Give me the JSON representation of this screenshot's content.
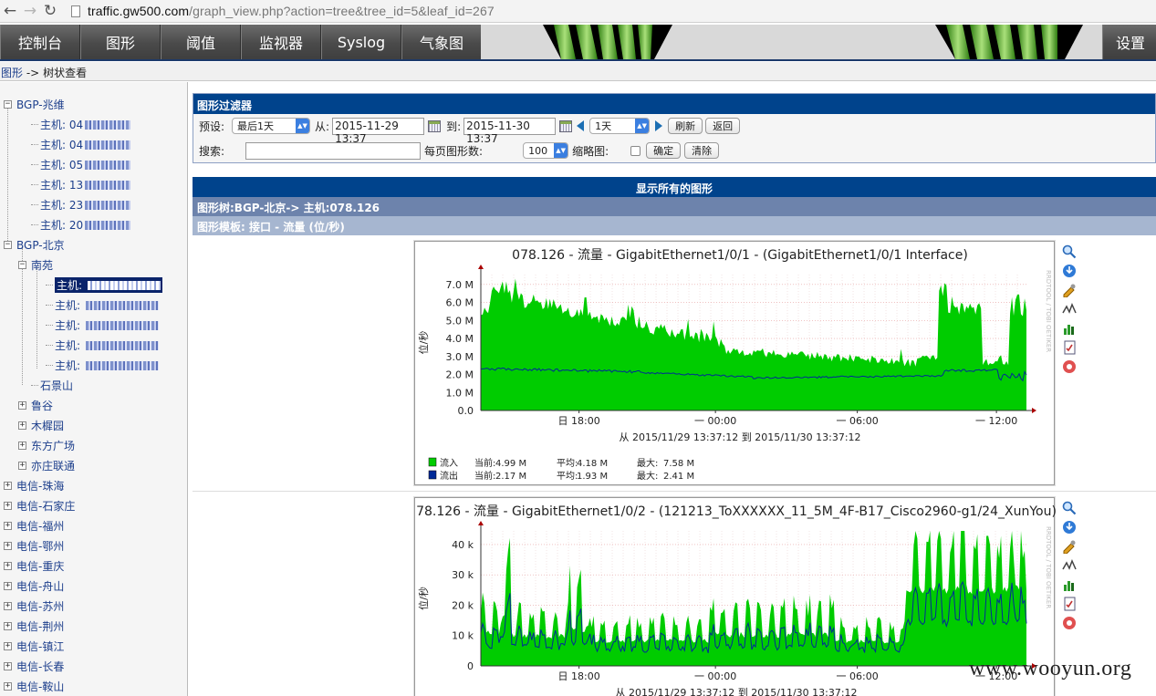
{
  "browser": {
    "url_host": "traffic.gw500.com",
    "url_path": "/graph_view.php?action=tree&tree_id=5&leaf_id=267"
  },
  "menu": {
    "tabs": [
      "控制台",
      "图形",
      "阈值",
      "监视器",
      "Syslog",
      "气象图"
    ],
    "settings": "设置"
  },
  "breadcrumb": {
    "link": "图形",
    "sep": "->",
    "current": "树状查看"
  },
  "tree": [
    {
      "label": "BGP-兆维",
      "toggle": "⊟"
    },
    {
      "label": "主机: 04",
      "blur": true
    },
    {
      "label": "主机: 04",
      "blur": true
    },
    {
      "label": "主机: 05",
      "blur": true
    },
    {
      "label": "主机: 13",
      "blur": true
    },
    {
      "label": "主机: 23",
      "blur": true
    },
    {
      "label": "主机: 20",
      "blur": true
    },
    {
      "label": "BGP-北京",
      "toggle": "⊟"
    },
    {
      "label": "南苑",
      "toggle": "⊟"
    },
    {
      "label": "主机: ",
      "blur": true,
      "selected": true
    },
    {
      "label": "主机: ",
      "blur": true
    },
    {
      "label": "主机: ",
      "blur": true
    },
    {
      "label": "主机: ",
      "blur": true
    },
    {
      "label": "主机: ",
      "blur": true
    },
    {
      "label": "石景山"
    },
    {
      "label": "鲁谷",
      "toggle": "⊞"
    },
    {
      "label": "木樨园",
      "toggle": "⊞"
    },
    {
      "label": "东方广场",
      "toggle": "⊞"
    },
    {
      "label": "亦庄联通",
      "toggle": "⊞"
    },
    {
      "label": "电信-珠海",
      "toggle": "⊞"
    },
    {
      "label": "电信-石家庄",
      "toggle": "⊞"
    },
    {
      "label": "电信-福州",
      "toggle": "⊞"
    },
    {
      "label": "电信-鄂州",
      "toggle": "⊞"
    },
    {
      "label": "电信-重庆",
      "toggle": "⊞"
    },
    {
      "label": "电信-舟山",
      "toggle": "⊞"
    },
    {
      "label": "电信-苏州",
      "toggle": "⊞"
    },
    {
      "label": "电信-荆州",
      "toggle": "⊞"
    },
    {
      "label": "电信-镇江",
      "toggle": "⊞"
    },
    {
      "label": "电信-长春",
      "toggle": "⊞"
    },
    {
      "label": "电信-鞍山",
      "toggle": "⊞"
    }
  ],
  "filter": {
    "title": "图形过滤器",
    "preset_label": "预设:",
    "preset_value": "最后1天",
    "from_label": "从:",
    "from_value": "2015-11-29 13:37",
    "to_label": "到:",
    "to_value": "2015-11-30 13:37",
    "span_value": "1天",
    "refresh": "刷新",
    "back": "返回",
    "search_label": "搜索:",
    "search_value": "",
    "per_page_label": "每页图形数:",
    "per_page_value": "100",
    "thumb_label": "缩略图:",
    "confirm": "确定",
    "clear": "清除"
  },
  "section": {
    "all_graphs": "显示所有的图形",
    "tree_path": "图形树:BGP-北京-> 主机:078.126",
    "template": "图形模板: 接口 - 流量 (位/秒)"
  },
  "colors": {
    "inbound": "#00cc00",
    "outbound": "#002a97",
    "header": "#00438c"
  },
  "graph_icons": [
    "zoom-icon",
    "download-icon",
    "edit-icon",
    "line-icon",
    "bar-icon",
    "report-icon",
    "remove-icon"
  ],
  "graphs": [
    {
      "title": "078.126 - 流量 - GigabitEthernet1/0/1 - (GigabitEthernet1/0/1 Interface)",
      "ylabel": "位/秒",
      "side_label": "RRDTOOL / TOBI OETIKER",
      "yticks": [
        "0.0",
        "1.0 M",
        "2.0 M",
        "3.0 M",
        "4.0 M",
        "5.0 M",
        "6.0 M",
        "7.0 M"
      ],
      "xticks": [
        "日 18:00",
        "一 00:00",
        "一 06:00",
        "一 12:00"
      ],
      "caption": "从 2015/11/29 13:37:12 到 2015/11/30 13:37:12",
      "legend": [
        {
          "name": "流入",
          "cur_label": "当前:",
          "cur": "4.99 M",
          "avg_label": "平均:",
          "avg": "4.18 M",
          "max_label": "最大:",
          "max": "7.58 M"
        },
        {
          "name": "流出",
          "cur_label": "当前:",
          "cur": "2.17 M",
          "avg_label": "平均:",
          "avg": "1.93 M",
          "max_label": "最大:",
          "max": "2.41 M"
        }
      ]
    },
    {
      "title": "78.126 - 流量 - GigabitEthernet1/0/2 - (121213_ToXXXXXX_11_5M_4F-B17_Cisco2960-g1/24_XunYou)",
      "ylabel": "位/秒",
      "side_label": "RRDTOOL / TOBI OETIKER",
      "yticks": [
        "0",
        "10 k",
        "20 k",
        "30 k",
        "40 k"
      ],
      "xticks": [
        "日 18:00",
        "一 00:00",
        "一 06:00",
        "一 12:00"
      ],
      "caption": "从 2015/11/29 13:37:12 到 2015/11/30 13:37:12"
    }
  ],
  "watermark": "www.wooyun.org"
}
